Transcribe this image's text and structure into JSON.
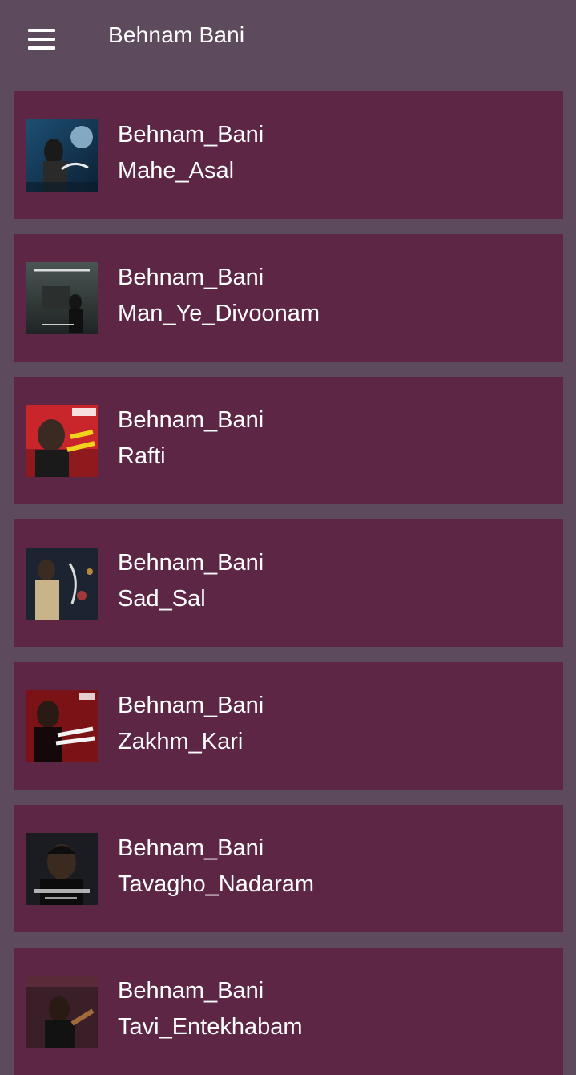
{
  "app_bar": {
    "title": "Behnam Bani",
    "menu_icon": "hamburger-menu-icon"
  },
  "colors": {
    "background": "#5d4a5c",
    "card": "#5c2644",
    "text": "#ffffff"
  },
  "songs": [
    {
      "artist": "Behnam_Bani",
      "title": "Mahe_Asal"
    },
    {
      "artist": "Behnam_Bani",
      "title": "Man_Ye_Divoonam"
    },
    {
      "artist": "Behnam_Bani",
      "title": "Rafti"
    },
    {
      "artist": "Behnam_Bani",
      "title": "Sad_Sal"
    },
    {
      "artist": "Behnam_Bani",
      "title": "Zakhm_Kari"
    },
    {
      "artist": "Behnam_Bani",
      "title": "Tavagho_Nadaram"
    },
    {
      "artist": "Behnam_Bani",
      "title": "Tavi_Entekhabam"
    }
  ]
}
